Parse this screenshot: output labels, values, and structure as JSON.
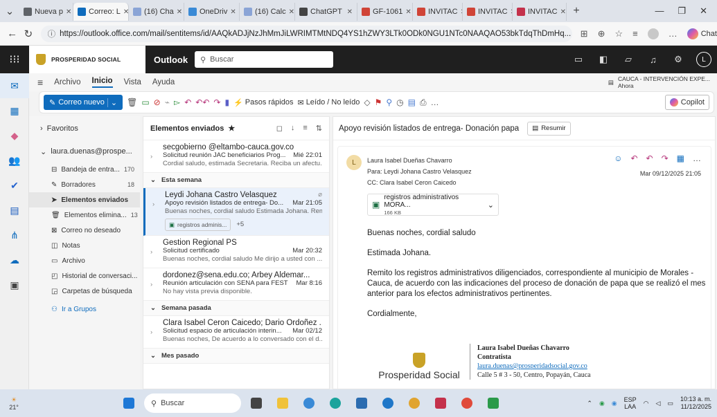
{
  "tabs": [
    {
      "label": "Nueva p",
      "color": "#5f6368"
    },
    {
      "label": "Correo: L",
      "color": "#0f6cbd",
      "active": true
    },
    {
      "label": "(16) Cha",
      "color": "#8aa4d6"
    },
    {
      "label": "OneDriv",
      "color": "#3a8ad6"
    },
    {
      "label": "(16) Calc",
      "color": "#8aa4d6"
    },
    {
      "label": "ChatGPT",
      "color": "#444"
    },
    {
      "label": "GF-1061",
      "color": "#d04437"
    },
    {
      "label": "INVITAC",
      "color": "#d04437"
    },
    {
      "label": "INVITAC",
      "color": "#d04437"
    },
    {
      "label": "INVITAC",
      "color": "#c4314b"
    }
  ],
  "browser": {
    "url": "https://outlook.office.com/mail/sentitems/id/AAQkADJjNzJhMmJiLWRIMTMtNDQ4YS1hZWY3LTk0ODk0NGU1NTc0NAAQAO53bkTdqThDmHq...",
    "chat_label": "Chat"
  },
  "app": {
    "org": "PROSPERIDAD SOCIAL",
    "name": "Outlook",
    "search_placeholder": "Buscar"
  },
  "ribbon_tabs": [
    "Archivo",
    "Inicio",
    "Vista",
    "Ayuda"
  ],
  "notification": {
    "title": "CAUCA - INTERVENCIÓN EXPE...",
    "time": "Ahora"
  },
  "ribbon": {
    "new_mail": "Correo nuevo",
    "quick_steps": "Pasos rápidos",
    "read_unread": "Leído / No leído",
    "copilot": "Copilot"
  },
  "folders": {
    "favorites": "Favoritos",
    "account": "laura.duenas@prospe...",
    "items": [
      {
        "label": "Bandeja de entra...",
        "count": "170",
        "icon": "inbox-icon"
      },
      {
        "label": "Borradores",
        "count": "18",
        "icon": "pencil-icon"
      },
      {
        "label": "Elementos enviados",
        "count": "",
        "icon": "send-icon",
        "selected": true
      },
      {
        "label": "Elementos elimina...",
        "count": "13",
        "icon": "trash-icon"
      },
      {
        "label": "Correo no deseado",
        "count": "",
        "icon": "junk-icon"
      },
      {
        "label": "Notas",
        "count": "",
        "icon": "note-icon"
      },
      {
        "label": "Archivo",
        "count": "",
        "icon": "archive-icon"
      },
      {
        "label": "Historial de conversaci...",
        "count": "",
        "icon": "folder-icon"
      },
      {
        "label": "Carpetas de búsqueda",
        "count": "",
        "icon": "search-folder-icon"
      }
    ],
    "groups_link": "Ir a Grupos"
  },
  "list": {
    "title": "Elementos enviados",
    "messages": [
      {
        "from": "secgobierno @eltambo-cauca.gov.co",
        "subject": "Solicitud reunión JAC beneficiarios Prog...",
        "time": "Mié 22:01",
        "preview": "Cordial saludo, estimada Secretaria. Reciba un afectu..."
      },
      {
        "group": "Esta semana"
      },
      {
        "from": "Leydi Johana Castro Velasquez",
        "subject": "Apoyo revisión listados de entrega- Do...",
        "time": "Mar 21:05",
        "preview": "Buenas noches, cordial saludo Estimada Johana. Rem...",
        "attachment": "registros adminis...",
        "more": "+5",
        "selected": true
      },
      {
        "from": "Gestion Regional PS",
        "subject": "Solicitud certificado",
        "time": "Mar 20:32",
        "preview": "Buenas noches, cordial saludo Me dirijo a usted con ..."
      },
      {
        "from": "dordonez@sena.edu.co; Arbey Aldemar...",
        "subject": "Reunión articulación con SENA para FEST",
        "time": "Mar 8:16",
        "preview": "No hay vista previa disponible."
      },
      {
        "group": "Semana pasada"
      },
      {
        "from": "Clara Isabel Ceron Caicedo; Dario Ordoñez ...",
        "subject": "Solicitud espacio de articulación interin...",
        "time": "Mar 02/12",
        "preview": "Buenas noches, De acuerdo a lo conversado con el d..."
      },
      {
        "group": "Mes pasado"
      }
    ]
  },
  "reading": {
    "subject": "Apoyo revisión listados de entrega- Donación papa",
    "summarize": "Resumir",
    "sender": "Laura Isabel Dueñas Chavarro",
    "avatar_initial": "L",
    "to": "Para:  Leydi Johana Castro Velasquez",
    "cc": "CC:  Clara Isabel Ceron Caicedo",
    "date": "Mar 09/12/2025 21:05",
    "attachment_name": "registros administrativos MORA...",
    "attachment_size": "166 KB",
    "body": [
      "Buenas noches, cordial saludo",
      "Estimada Johana.",
      "Remito los registros administrativos diligenciados, correspondiente al municipio de Morales - Cauca, de acuerdo con las indicaciones del proceso de donación de papa que se realizó el mes anterior para los efectos administrativos pertinentes.",
      "Cordialmente,"
    ],
    "signature": {
      "name": "Laura Isabel Dueñas Chavarro",
      "role": "Contratista",
      "email": "laura.duenas@prosperidadsocial.gov.co",
      "address": "Calle 5 # 3 - 50, Centro, Popayán, Cauca",
      "logo_text": "Prosperidad Social"
    }
  },
  "taskbar": {
    "weather": "21°",
    "search": "Buscar",
    "lang": "ESP",
    "lang2": "LAA",
    "time": "10:13 a. m.",
    "date": "11/12/2025"
  }
}
